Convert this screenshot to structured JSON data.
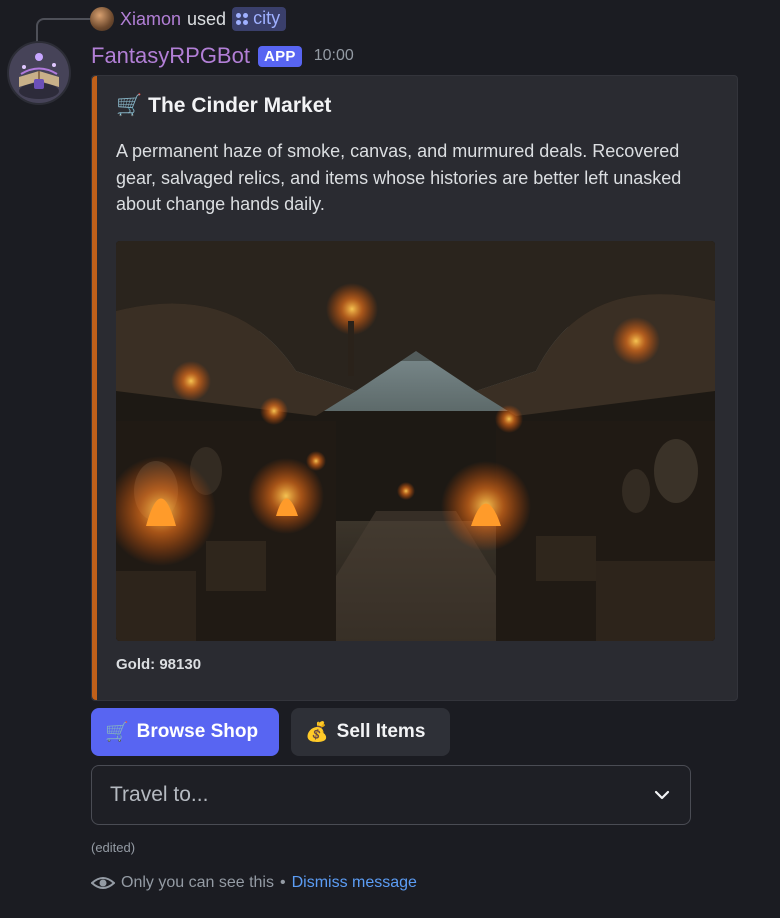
{
  "reply": {
    "user": "Xiamon",
    "used": "used",
    "command": "city"
  },
  "message": {
    "bot_name": "FantasyRPGBot",
    "badge": "APP",
    "timestamp": "10:00"
  },
  "embed": {
    "title_emoji": "🛒",
    "title": "The Cinder Market",
    "description": "A permanent haze of smoke, canvas, and murmured deals. Recovered gear, salvaged relics, and items whose histories are better left unasked about change hands daily.",
    "footer": "Gold: 98130",
    "accent_color": "#c0601a"
  },
  "buttons": [
    {
      "emoji": "🛒",
      "label": "Browse Shop",
      "style": "primary"
    },
    {
      "emoji": "💰",
      "label": "Sell Items",
      "style": "secondary"
    }
  ],
  "select": {
    "placeholder": "Travel to..."
  },
  "edited_label": "(edited)",
  "ephemeral": {
    "text": "Only you can see this",
    "separator": "•",
    "dismiss_label": "Dismiss message"
  },
  "colors": {
    "background": "#1b1c22",
    "embed_background": "#2a2b31",
    "blurple": "#5865f2",
    "username": "#b27fd6",
    "link": "#5c9df5"
  }
}
